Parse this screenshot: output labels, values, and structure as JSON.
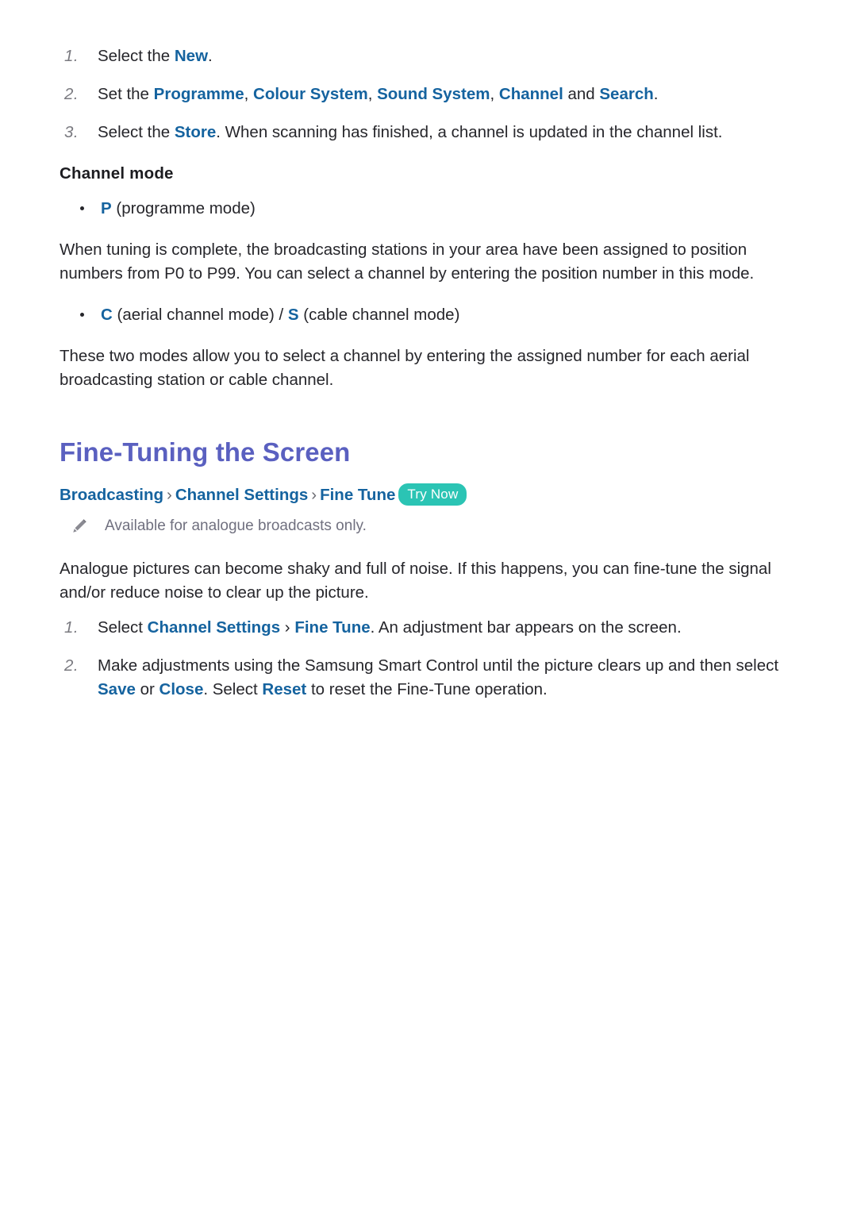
{
  "document": {
    "steps_top": [
      {
        "number": "1.",
        "segments": [
          {
            "text": "Select the ",
            "style": "plain"
          },
          {
            "text": "New",
            "style": "link"
          },
          {
            "text": ".",
            "style": "plain"
          }
        ]
      },
      {
        "number": "2.",
        "segments": [
          {
            "text": "Set the ",
            "style": "plain"
          },
          {
            "text": "Programme",
            "style": "link"
          },
          {
            "text": ", ",
            "style": "plain"
          },
          {
            "text": "Colour System",
            "style": "link"
          },
          {
            "text": ", ",
            "style": "plain"
          },
          {
            "text": "Sound System",
            "style": "link"
          },
          {
            "text": ", ",
            "style": "plain"
          },
          {
            "text": "Channel",
            "style": "link"
          },
          {
            "text": " and ",
            "style": "plain"
          },
          {
            "text": "Search",
            "style": "link"
          },
          {
            "text": ".",
            "style": "plain"
          }
        ]
      },
      {
        "number": "3.",
        "segments": [
          {
            "text": "Select the ",
            "style": "plain"
          },
          {
            "text": "Store",
            "style": "link"
          },
          {
            "text": ". When scanning has finished, a channel is updated in the channel list.",
            "style": "plain"
          }
        ]
      }
    ],
    "channel_mode": {
      "heading": "Channel mode",
      "bullet_p_label": "P",
      "bullet_p_text": " (programme mode)",
      "paragraph_p": "When tuning is complete, the broadcasting stations in your area have been assigned to position numbers from P0 to P99. You can select a channel by entering the position number in this mode.",
      "bullet_cs_c": "C",
      "bullet_cs_mid1": " (aerial channel mode) / ",
      "bullet_cs_s": "S",
      "bullet_cs_mid2": " (cable channel mode)",
      "paragraph_cs": "These two modes allow you to select a channel by entering the assigned number for each aerial broadcasting station or cable channel."
    },
    "section": {
      "title": "Fine-Tuning the Screen",
      "breadcrumb": {
        "item1": "Broadcasting",
        "sep1": "›",
        "item2": "Channel Settings",
        "sep2": "›",
        "item3": "Fine Tune",
        "badge": "Try Now"
      },
      "note": {
        "icon": "pencil-icon",
        "text": "Available for analogue broadcasts only."
      },
      "intro": "Analogue pictures can become shaky and full of noise. If this happens, you can fine-tune the signal and/or reduce noise to clear up the picture.",
      "steps": [
        {
          "number": "1.",
          "segments": [
            {
              "text": "Select ",
              "style": "plain"
            },
            {
              "text": "Channel Settings",
              "style": "link"
            },
            {
              "text": " › ",
              "style": "plain"
            },
            {
              "text": "Fine Tune",
              "style": "link"
            },
            {
              "text": ". An adjustment bar appears on the screen.",
              "style": "plain"
            }
          ]
        },
        {
          "number": "2.",
          "segments": [
            {
              "text": "Make adjustments using the Samsung Smart Control until the picture clears up and then select ",
              "style": "plain"
            },
            {
              "text": "Save",
              "style": "link"
            },
            {
              "text": " or ",
              "style": "plain"
            },
            {
              "text": "Close",
              "style": "link"
            },
            {
              "text": ". Select ",
              "style": "plain"
            },
            {
              "text": "Reset",
              "style": "link"
            },
            {
              "text": " to reset the Fine-Tune operation.",
              "style": "plain"
            }
          ]
        }
      ]
    },
    "colors": {
      "link_blue": "#15639f",
      "heading_indigo": "#5a60c0",
      "badge_teal": "#2bc4b4",
      "body_text": "#26262b",
      "muted_text": "#70707f",
      "number_grey": "#7a7a80"
    }
  }
}
